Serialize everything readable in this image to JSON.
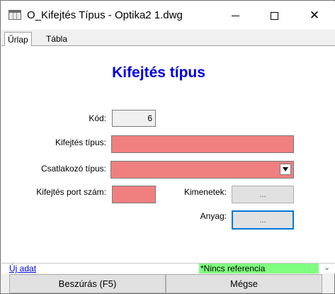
{
  "window": {
    "title": "O_Kifejtés Típus - Optika2 1.dwg",
    "minimize_glyph": "—",
    "close_glyph": "✕"
  },
  "tabs": [
    {
      "label": "Űrlap",
      "active": true
    },
    {
      "label": "Tábla",
      "active": false
    }
  ],
  "form": {
    "heading": "Kifejtés típus",
    "kod_label": "Kód:",
    "kod_value": "6",
    "kifejtes_tipus_label": "Kifejtés típus:",
    "kifejtes_tipus_value": "",
    "csatlakozo_label": "Csatlakozó típus:",
    "csatlakozo_value": "",
    "port_label": "Kifejtés port szám:",
    "port_value": "",
    "kimenetek_label": "Kimenetek:",
    "kimenetek_button": "...",
    "anyag_label": "Anyag:",
    "anyag_button": "..."
  },
  "status": {
    "left_link": "Új adat",
    "reference": "*Nincs referencia",
    "chevron": "⌄"
  },
  "buttons": {
    "insert": "Beszúrás (F5)",
    "cancel": "Mégse"
  },
  "colors": {
    "heading": "#0000e6",
    "required_field": "#f08080",
    "status_green": "#80ff80"
  }
}
